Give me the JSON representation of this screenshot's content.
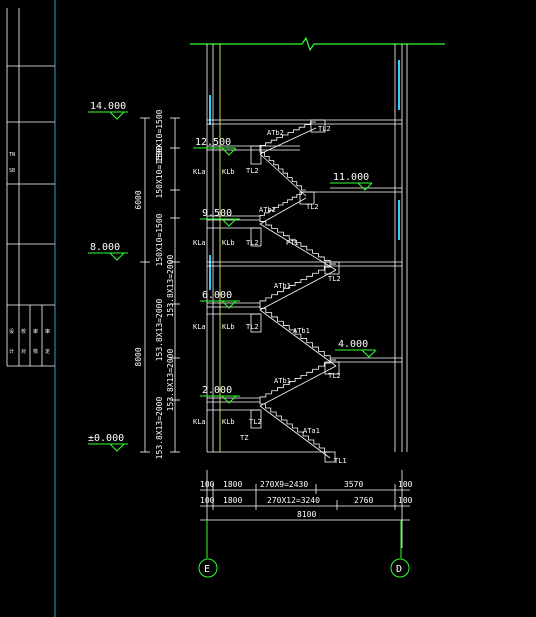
{
  "title_block": {
    "row_texts": [
      "TN",
      "SB"
    ],
    "sig_cols": [
      "设",
      "校",
      "审",
      "审"
    ],
    "sig_vals": [
      "计",
      "对",
      "核",
      "定"
    ]
  },
  "elevations": {
    "top": "14.000",
    "e12": "12.500",
    "e11": "11.000",
    "e9": "9.500",
    "e8": "8.000",
    "e6": "6.000",
    "e4": "4.000",
    "e2": "2.000",
    "e0": "±0.000"
  },
  "dims_vertical": {
    "d6000": "6000",
    "d8000": "8000",
    "s1": "150X10=1500",
    "s2": "150X10=1500",
    "s3": "150X10=1500",
    "s4": "153.8X13=2000",
    "s5": "153.8X13=2000",
    "s6": "153.8X13=2000",
    "s7": "153.8X13=2000"
  },
  "dims_horizontal": {
    "row1": [
      "100",
      "1800",
      "270X9=2430",
      "3570",
      "100"
    ],
    "row2": [
      "100",
      "1800",
      "270X12=3240",
      "2760",
      "100"
    ],
    "total": "8100"
  },
  "labels": {
    "atb2a": "ATb2",
    "atb2b": "ATb2",
    "atb1a": "ATb1",
    "atb1b": "ATb1",
    "atb1c": "ATb1",
    "ata1": "ATa1",
    "tl2a": "TL2",
    "tl2b": "TL2",
    "tl2c": "TL2",
    "tl2d": "TL2",
    "tl2e": "TL2",
    "tl2f": "TL2",
    "tl2g": "TL2",
    "tl2h": "TL2",
    "tl2i": "TL2",
    "tl1": "TL1",
    "tz": "TZ",
    "kla1": "KLa",
    "kla2": "KLa",
    "kla3": "KLa",
    "kla4": "KLa",
    "kla5": "KLa",
    "klb1": "KLb",
    "klb2": "KLb",
    "klb3": "KLb",
    "klb4": "KLb",
    "klb5": "KLb",
    "pt1": "PT1"
  },
  "axes": {
    "left": "E",
    "right": "D"
  },
  "colors": {
    "background": "#000000",
    "green": "#33ff33",
    "yellow": "#ffff66",
    "cyan": "#33ccff",
    "white": "#ffffff"
  }
}
